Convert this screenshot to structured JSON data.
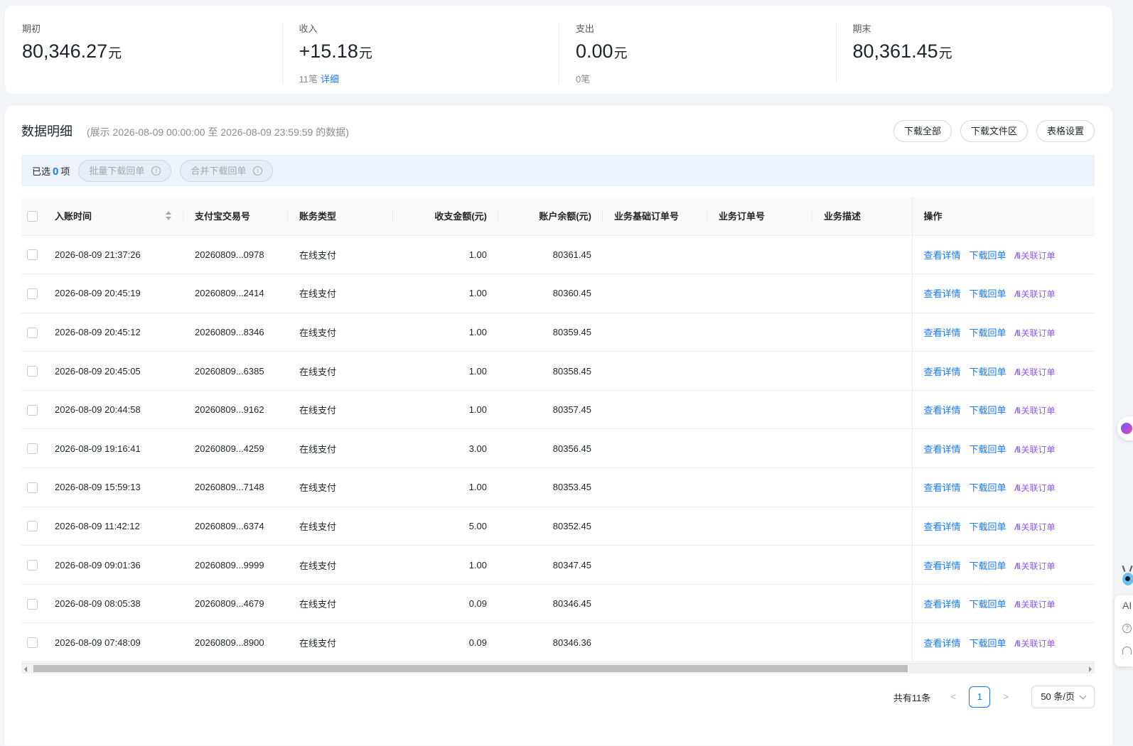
{
  "summary": {
    "unit": "元",
    "opening": {
      "label": "期初",
      "value": "80,346.27"
    },
    "income": {
      "label": "收入",
      "value": "+15.18",
      "count": "11笔",
      "detail": "详细"
    },
    "expense": {
      "label": "支出",
      "value": "0.00",
      "count": "0笔"
    },
    "closing": {
      "label": "期末",
      "value": "80,361.45"
    }
  },
  "panel": {
    "title": "数据明细",
    "range": "(展示 2026-08-09 00:00:00 至 2026-08-09 23:59:59 的数据)",
    "buttons": {
      "download_all": "下载全部",
      "download_area": "下载文件区",
      "table_settings": "表格设置"
    }
  },
  "selection": {
    "prefix": "已选",
    "count": "0",
    "suffix": "项",
    "batch_download": "批量下载回单",
    "merge_download": "合并下载回单"
  },
  "table": {
    "columns": {
      "time": "入账时间",
      "trade_no": "支付宝交易号",
      "type": "账务类型",
      "amount": "收支金额(元)",
      "balance": "账户余额(元)",
      "base_order": "业务基础订单号",
      "order": "业务订单号",
      "desc": "业务描述",
      "actions": "操作"
    },
    "actions": {
      "view": "查看详情",
      "receipt": "下载回单",
      "link": "关联订单"
    },
    "rows": [
      {
        "time": "2026-08-09 21:37:26",
        "trade_no": "20260809...0978",
        "type": "在线支付",
        "amount": "1.00",
        "balance": "80361.45"
      },
      {
        "time": "2026-08-09 20:45:19",
        "trade_no": "20260809...2414",
        "type": "在线支付",
        "amount": "1.00",
        "balance": "80360.45"
      },
      {
        "time": "2026-08-09 20:45:12",
        "trade_no": "20260809...8346",
        "type": "在线支付",
        "amount": "1.00",
        "balance": "80359.45"
      },
      {
        "time": "2026-08-09 20:45:05",
        "trade_no": "20260809...6385",
        "type": "在线支付",
        "amount": "1.00",
        "balance": "80358.45"
      },
      {
        "time": "2026-08-09 20:44:58",
        "trade_no": "20260809...9162",
        "type": "在线支付",
        "amount": "1.00",
        "balance": "80357.45"
      },
      {
        "time": "2026-08-09 19:16:41",
        "trade_no": "20260809...4259",
        "type": "在线支付",
        "amount": "3.00",
        "balance": "80356.45"
      },
      {
        "time": "2026-08-09 15:59:13",
        "trade_no": "20260809...7148",
        "type": "在线支付",
        "amount": "1.00",
        "balance": "80353.45"
      },
      {
        "time": "2026-08-09 11:42:12",
        "trade_no": "20260809...6374",
        "type": "在线支付",
        "amount": "5.00",
        "balance": "80352.45"
      },
      {
        "time": "2026-08-09 09:01:36",
        "trade_no": "20260809...9999",
        "type": "在线支付",
        "amount": "1.00",
        "balance": "80347.45"
      },
      {
        "time": "2026-08-09 08:05:38",
        "trade_no": "20260809...4679",
        "type": "在线支付",
        "amount": "0.09",
        "balance": "80346.45"
      },
      {
        "time": "2026-08-09 07:48:09",
        "trade_no": "20260809...8900",
        "type": "在线支付",
        "amount": "0.09",
        "balance": "80346.36"
      }
    ]
  },
  "pagination": {
    "total": "共有11条",
    "current_page": "1",
    "page_size": "50 条/页"
  },
  "floating": {
    "ai_label": "AI"
  },
  "colors": {
    "accent": "#1677ff",
    "ai_purple": "#8a5cf6"
  }
}
